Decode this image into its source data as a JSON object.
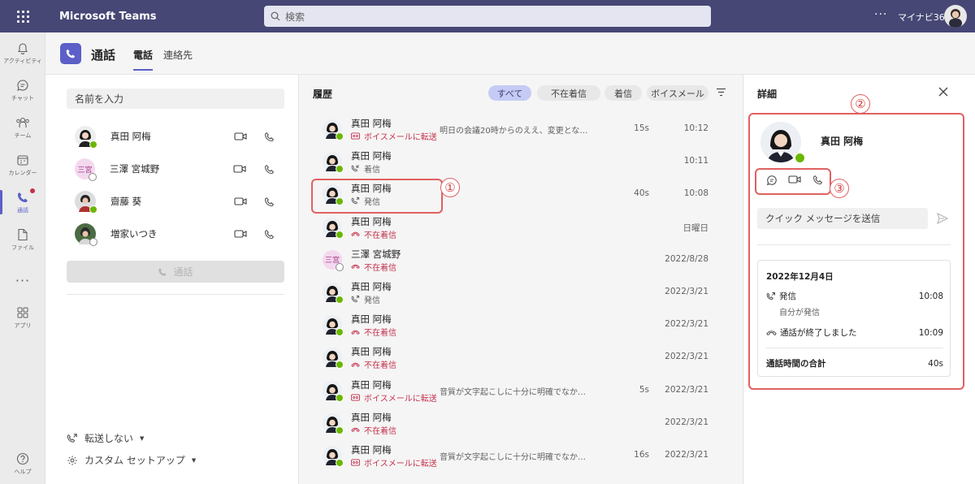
{
  "app": {
    "title": "Microsoft Teams",
    "search_placeholder": "検索",
    "more": "···",
    "tenant": "マイナビ365"
  },
  "rail": [
    {
      "label": "アクティビティ",
      "icon": "bell-icon"
    },
    {
      "label": "チャット",
      "icon": "chat-icon"
    },
    {
      "label": "チーム",
      "icon": "teams-icon"
    },
    {
      "label": "カレンダー",
      "icon": "calendar-icon"
    },
    {
      "label": "通話",
      "icon": "phone-icon",
      "active": true
    },
    {
      "label": "ファイル",
      "icon": "file-icon"
    },
    {
      "label": "",
      "icon": "more-icon"
    },
    {
      "label": "アプリ",
      "icon": "apps-icon"
    },
    {
      "label": "ヘルプ",
      "icon": "help-icon"
    }
  ],
  "header": {
    "title": "通話",
    "tabs": [
      "電話",
      "連絡先"
    ]
  },
  "dial": {
    "name_placeholder": "名前を入力",
    "contacts": [
      "真田 阿梅",
      "三澤 宮城野",
      "齋藤 葵",
      "増家いつき"
    ],
    "initials": "三宮",
    "call_button": "通話",
    "forward": "転送しない",
    "custom_setup": "カスタム セットアップ"
  },
  "history": {
    "title": "履歴",
    "filters": [
      "すべて",
      "不在着信",
      "着信",
      "ボイスメール"
    ],
    "rows": [
      {
        "name": "真田 阿梅",
        "status": "ボイスメールに転送",
        "kind": "vm",
        "preview": "明日の会議20時からのええ、変更となりまし...",
        "duration": "15s",
        "time": "10:12",
        "avatar": "photo"
      },
      {
        "name": "真田 阿梅",
        "status": "着信",
        "kind": "in",
        "preview": "",
        "duration": "",
        "time": "10:11",
        "avatar": "photo"
      },
      {
        "name": "真田 阿梅",
        "status": "発信",
        "kind": "out",
        "preview": "",
        "duration": "40s",
        "time": "10:08",
        "avatar": "photo"
      },
      {
        "name": "真田 阿梅",
        "status": "不在着信",
        "kind": "miss",
        "preview": "",
        "duration": "",
        "time": "日曜日",
        "avatar": "photo"
      },
      {
        "name": "三澤 宮城野",
        "status": "不在着信",
        "kind": "miss",
        "preview": "",
        "duration": "",
        "time": "2022/8/28",
        "avatar": "initials"
      },
      {
        "name": "真田 阿梅",
        "status": "発信",
        "kind": "out",
        "preview": "",
        "duration": "",
        "time": "2022/3/21",
        "avatar": "photo"
      },
      {
        "name": "真田 阿梅",
        "status": "不在着信",
        "kind": "miss",
        "preview": "",
        "duration": "",
        "time": "2022/3/21",
        "avatar": "photo"
      },
      {
        "name": "真田 阿梅",
        "status": "不在着信",
        "kind": "miss",
        "preview": "",
        "duration": "",
        "time": "2022/3/21",
        "avatar": "photo"
      },
      {
        "name": "真田 阿梅",
        "status": "ボイスメールに転送",
        "kind": "vm",
        "preview": "音質が文字起こしに十分に明確でなかったた...",
        "duration": "5s",
        "time": "2022/3/21",
        "avatar": "photo"
      },
      {
        "name": "真田 阿梅",
        "status": "不在着信",
        "kind": "miss",
        "preview": "",
        "duration": "",
        "time": "2022/3/21",
        "avatar": "photo"
      },
      {
        "name": "真田 阿梅",
        "status": "ボイスメールに転送",
        "kind": "vm",
        "preview": "音質が文字起こしに十分に明確でなかったた...",
        "duration": "16s",
        "time": "2022/3/21",
        "avatar": "photo"
      }
    ]
  },
  "detail": {
    "title": "詳細",
    "name": "真田 阿梅",
    "quick_message_placeholder": "クイック メッセージを送信",
    "date": "2022年12月4日",
    "outgoing_label": "発信",
    "outgoing_time": "10:08",
    "outgoing_sub": "自分が発信",
    "ended_label": "通話が終了しました",
    "ended_time": "10:09",
    "total_label": "通話時間の合計",
    "total_value": "40s"
  },
  "annotations": [
    "①",
    "②",
    "③"
  ],
  "colors": {
    "brand": "#464775",
    "accent": "#5b5fc7",
    "missed": "#c4314b",
    "presence": "#6bb700",
    "annotation": "#e06060"
  }
}
